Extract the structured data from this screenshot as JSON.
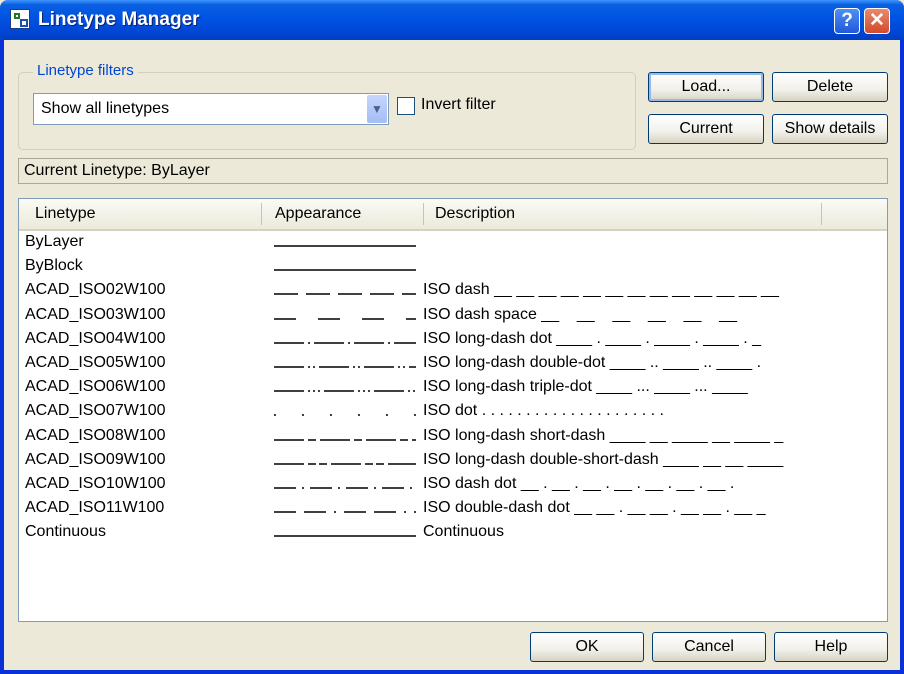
{
  "window": {
    "title": "Linetype Manager",
    "help_glyph": "?",
    "close_glyph": "✕"
  },
  "filters": {
    "group_label": "Linetype filters",
    "selected": "Show all linetypes",
    "dropdown_arrow": "▼",
    "invert_label": "Invert filter",
    "invert_checked": false
  },
  "buttons": {
    "load": "Load...",
    "delete": "Delete",
    "current": "Current",
    "show_details": "Show details",
    "ok": "OK",
    "cancel": "Cancel",
    "help": "Help"
  },
  "current_linetype": "Current Linetype:  ByLayer",
  "list": {
    "columns": [
      "Linetype",
      "Appearance",
      "Description"
    ],
    "rows": [
      {
        "name": "ByLayer",
        "dash": "solid",
        "description": ""
      },
      {
        "name": "ByBlock",
        "dash": "solid",
        "description": ""
      },
      {
        "name": "ACAD_ISO02W100",
        "dash": "dash",
        "description": "ISO dash __ __ __ __ __ __ __ __ __ __ __ __ __"
      },
      {
        "name": "ACAD_ISO03W100",
        "dash": "dash-space",
        "description": "ISO dash space __    __    __    __    __    __"
      },
      {
        "name": "ACAD_ISO04W100",
        "dash": "long-dash-dot",
        "description": "ISO long-dash dot ____ . ____ . ____ . ____ . _"
      },
      {
        "name": "ACAD_ISO05W100",
        "dash": "long-dash-double-dot",
        "description": "ISO long-dash double-dot ____ .. ____ .. ____ ."
      },
      {
        "name": "ACAD_ISO06W100",
        "dash": "long-dash-triple-dot",
        "description": "ISO long-dash triple-dot ____ ... ____ ... ____"
      },
      {
        "name": "ACAD_ISO07W100",
        "dash": "dot",
        "description": "ISO dot . . . . . . . . . . . . . . . . . . . . ."
      },
      {
        "name": "ACAD_ISO08W100",
        "dash": "long-dash-short-dash",
        "description": "ISO long-dash short-dash ____ __ ____ __ ____ _"
      },
      {
        "name": "ACAD_ISO09W100",
        "dash": "long-dash-double-short-dash",
        "description": "ISO long-dash double-short-dash ____ __ __ ____"
      },
      {
        "name": "ACAD_ISO10W100",
        "dash": "dash-dot",
        "description": "ISO dash dot __ . __ . __ . __ . __ . __ . __ ."
      },
      {
        "name": "ACAD_ISO11W100",
        "dash": "double-dash-dot",
        "description": "ISO double-dash dot __ __ . __ __ . __ __ . __ _"
      },
      {
        "name": "Continuous",
        "dash": "solid",
        "description": "Continuous"
      }
    ]
  },
  "colors": {
    "title_bar": "#0055e5",
    "dialog_bg": "#ece9d8",
    "group_label": "#0046d5",
    "close_button": "#d24a2a"
  }
}
